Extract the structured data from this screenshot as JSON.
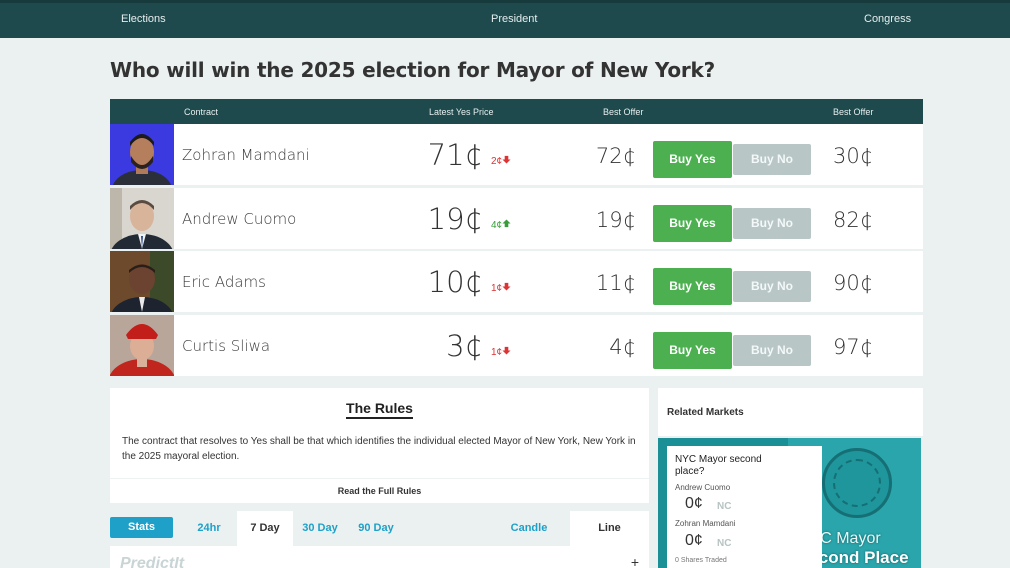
{
  "nav": {
    "elections": "Elections",
    "president": "President",
    "congress": "Congress"
  },
  "page": {
    "title": "Who will win the 2025 election for Mayor of New York?"
  },
  "table": {
    "headers": {
      "contract": "Contract",
      "latest_yes_price": "Latest Yes Price",
      "best_offer_yes": "Best Offer",
      "best_offer_no": "Best Offer"
    },
    "rows": [
      {
        "name": "Zohran Mamdani",
        "price": "71¢",
        "change": "2¢",
        "direction": "down",
        "offer_yes": "72¢",
        "buy_yes": "Buy Yes",
        "buy_no": "Buy No",
        "offer_no": "30¢"
      },
      {
        "name": "Andrew Cuomo",
        "price": "19¢",
        "change": "4¢",
        "direction": "up",
        "offer_yes": "19¢",
        "buy_yes": "Buy Yes",
        "buy_no": "Buy No",
        "offer_no": "82¢"
      },
      {
        "name": "Eric Adams",
        "price": "10¢",
        "change": "1¢",
        "direction": "down",
        "offer_yes": "11¢",
        "buy_yes": "Buy Yes",
        "buy_no": "Buy No",
        "offer_no": "90¢"
      },
      {
        "name": "Curtis Sliwa",
        "price": "3¢",
        "change": "1¢",
        "direction": "down",
        "offer_yes": "4¢",
        "buy_yes": "Buy Yes",
        "buy_no": "Buy No",
        "offer_no": "97¢"
      }
    ]
  },
  "rules": {
    "title": "The Rules",
    "text": "The contract that resolves to Yes shall be that which identifies the individual elected Mayor of New York, New York in the 2025 mayoral election.",
    "link": "Read the Full Rules"
  },
  "stats": {
    "stats_label": "Stats",
    "tabs": [
      "24hr",
      "7 Day",
      "30 Day",
      "90 Day"
    ],
    "active_tab": "7 Day",
    "candle": "Candle",
    "line": "Line",
    "logo": "PredictIt",
    "expand": "+"
  },
  "related": {
    "title": "Related Markets",
    "card": {
      "question": "NYC Mayor second place?",
      "candidate1": "Andrew Cuomo",
      "price1": "0¢",
      "nc1": "NC",
      "candidate2": "Zohran Mamdani",
      "price2": "0¢",
      "nc2": "NC",
      "traded": "0 Shares Traded",
      "banner_line1": "NYC Mayor",
      "banner_line2": "Second Place"
    }
  },
  "colors": {
    "nav_bg": "#1f4a4d",
    "buy_yes": "#4caf50",
    "buy_no": "#b8c6c6",
    "down": "#dd3333",
    "up": "#3a9b3a",
    "accent": "#1fa0c8"
  },
  "icons": {
    "down": "arrow-down-icon",
    "up": "arrow-up-icon"
  }
}
